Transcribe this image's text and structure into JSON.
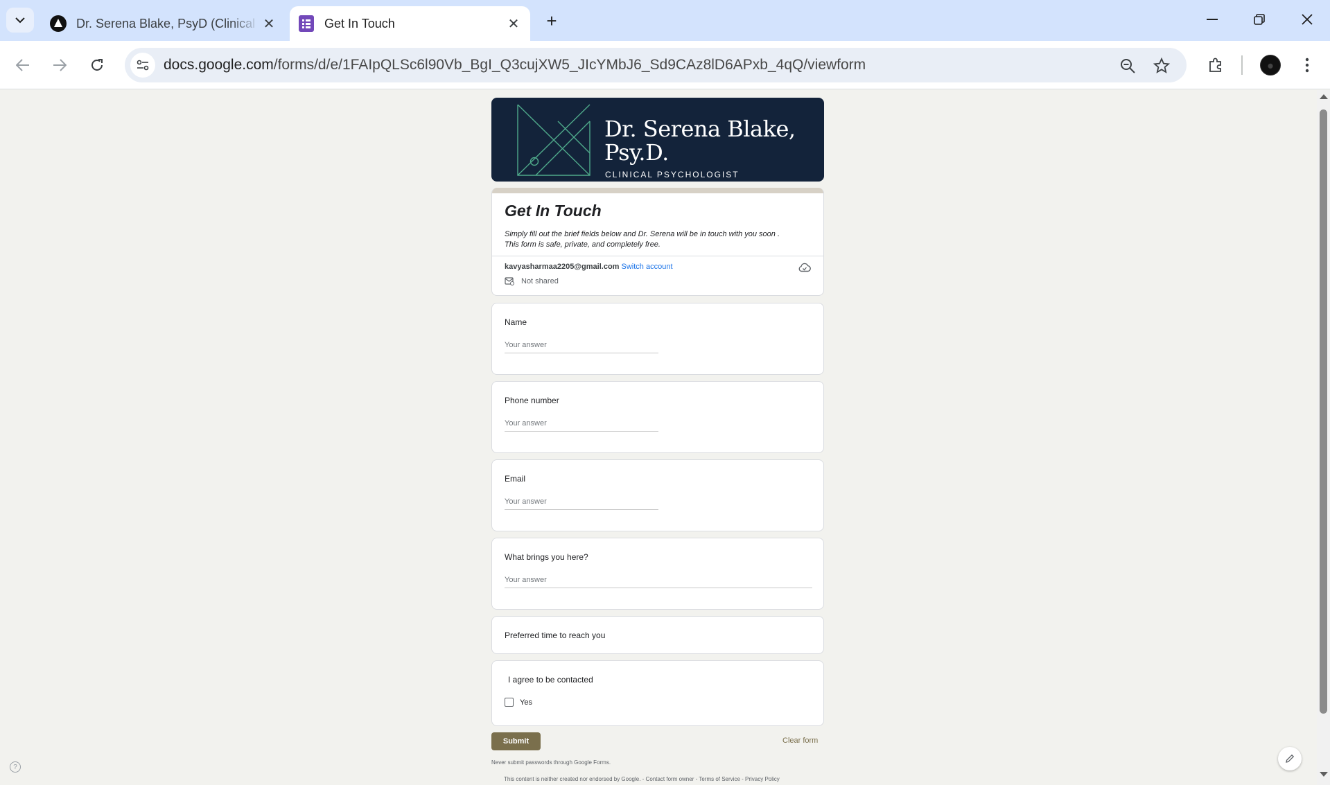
{
  "browser": {
    "tabs": [
      {
        "title": "Dr. Serena Blake, PsyD (Clinical Psychologist)"
      },
      {
        "title": "Get In Touch"
      }
    ],
    "url_host": "docs.google.com",
    "url_path": "/forms/d/e/1FAIpQLSc6l90Vb_BgI_Q3cujXW5_JIcYMbJ6_Sd9CAz8lD6APxb_4qQ/viewform"
  },
  "banner": {
    "name": "Dr. Serena Blake, Psy.D.",
    "subtitle": "CLINICAL PSYCHOLOGIST"
  },
  "form": {
    "title": "Get In Touch",
    "description_line1": "Simply fill out the brief fields below and Dr. Serena will be in touch with you soon .",
    "description_line2": "This form is safe, private, and completely free.",
    "account_email": "kavyasharmaa2205@gmail.com",
    "switch_account": "Switch account",
    "not_shared": "Not shared",
    "questions": [
      {
        "label": "Name",
        "placeholder": "Your answer"
      },
      {
        "label": "Phone number",
        "placeholder": "Your answer"
      },
      {
        "label": "Email",
        "placeholder": "Your answer"
      },
      {
        "label": "What brings you here?",
        "placeholder": "Your answer"
      }
    ],
    "preferred_time_label": "Preferred time to reach you",
    "agree_label": "I agree to be contacted",
    "agree_option": "Yes",
    "submit": "Submit",
    "clear": "Clear form",
    "warning": "Never submit passwords through Google Forms.",
    "footer": "This content is neither created nor endorsed by Google. - Contact form owner - Terms of Service - Privacy Policy"
  }
}
